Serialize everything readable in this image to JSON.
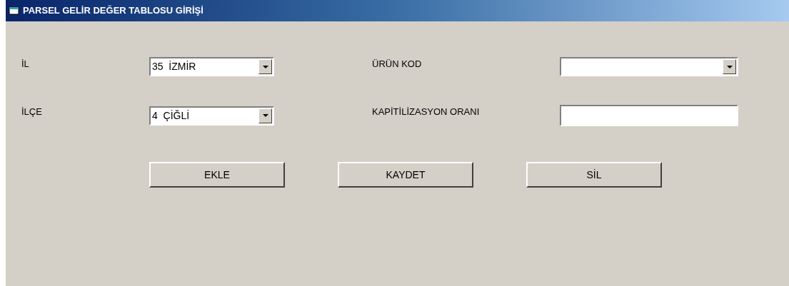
{
  "window": {
    "title": "PARSEL GELİR DEĞER TABLOSU GİRİŞİ"
  },
  "fields": [
    {
      "label": "İL",
      "kind": "combo",
      "value": "35  İZMİR"
    },
    {
      "label": "ÜRÜN KOD",
      "kind": "combo"
    },
    {
      "label": "İLÇE",
      "kind": "combo",
      "value": "4  ÇİĞLİ"
    },
    {
      "label": "KAPİTİLİZASYON ORANI",
      "kind": "text"
    }
  ],
  "buttons": [
    "EKLE",
    "KAYDET",
    "SİL"
  ]
}
